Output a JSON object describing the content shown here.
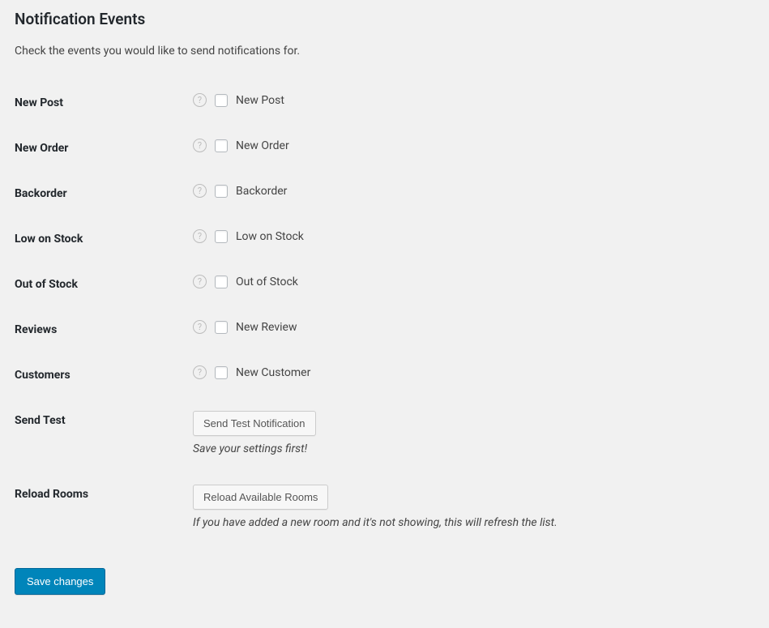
{
  "section": {
    "title": "Notification Events",
    "description": "Check the events you would like to send notifications for."
  },
  "rows": {
    "new_post": {
      "th": "New Post",
      "label": "New Post"
    },
    "new_order": {
      "th": "New Order",
      "label": "New Order"
    },
    "backorder": {
      "th": "Backorder",
      "label": "Backorder"
    },
    "low_stock": {
      "th": "Low on Stock",
      "label": "Low on Stock"
    },
    "out_of_stock": {
      "th": "Out of Stock",
      "label": "Out of Stock"
    },
    "reviews": {
      "th": "Reviews",
      "label": "New Review"
    },
    "customers": {
      "th": "Customers",
      "label": "New Customer"
    },
    "send_test": {
      "th": "Send Test",
      "button": "Send Test Notification",
      "hint": "Save your settings first!"
    },
    "reload_rooms": {
      "th": "Reload Rooms",
      "button": "Reload Available Rooms",
      "hint": "If you have added a new room and it's not showing, this will refresh the list."
    }
  },
  "submit": {
    "label": "Save changes"
  }
}
